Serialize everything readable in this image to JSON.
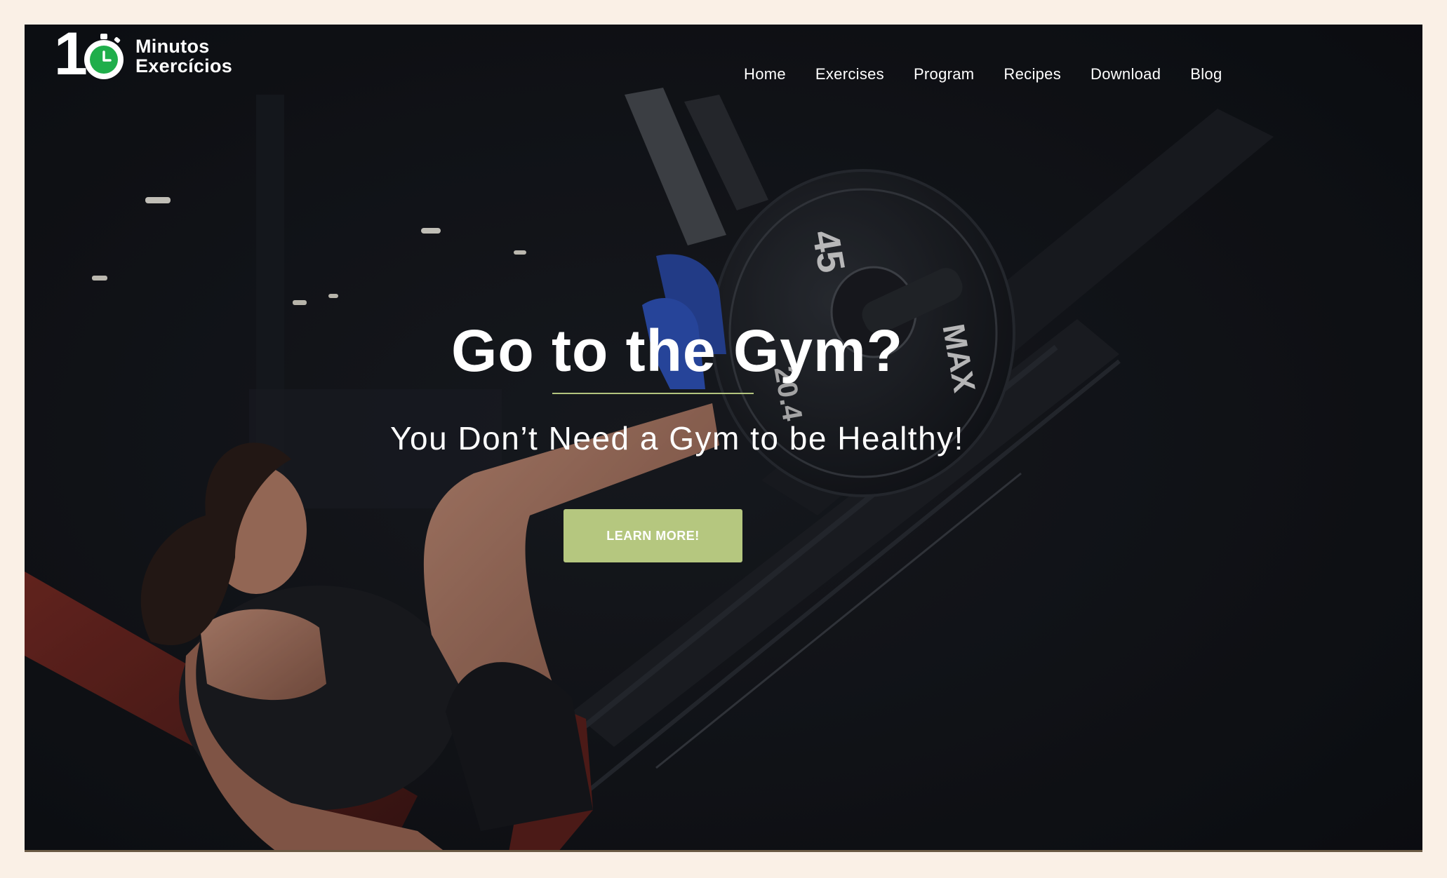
{
  "brand": {
    "number": "1",
    "line1": "Minutos",
    "line2": "Exercícios"
  },
  "nav": {
    "items": [
      {
        "label": "Home"
      },
      {
        "label": "Exercises"
      },
      {
        "label": "Program"
      },
      {
        "label": "Recipes"
      },
      {
        "label": "Download"
      },
      {
        "label": "Blog"
      }
    ]
  },
  "hero": {
    "title": "Go to the Gym?",
    "subtitle": "You Don’t Need a Gym to be Healthy!",
    "cta_label": "LEARN MORE!"
  },
  "photo": {
    "plate_label": "45",
    "plate_label_2": "20.4",
    "machine_label": "MAX"
  },
  "colors": {
    "accent": "#b5c77f",
    "clock_green": "#1fae4b",
    "page_background": "#faf0e6",
    "hero_background": "#14171c"
  }
}
